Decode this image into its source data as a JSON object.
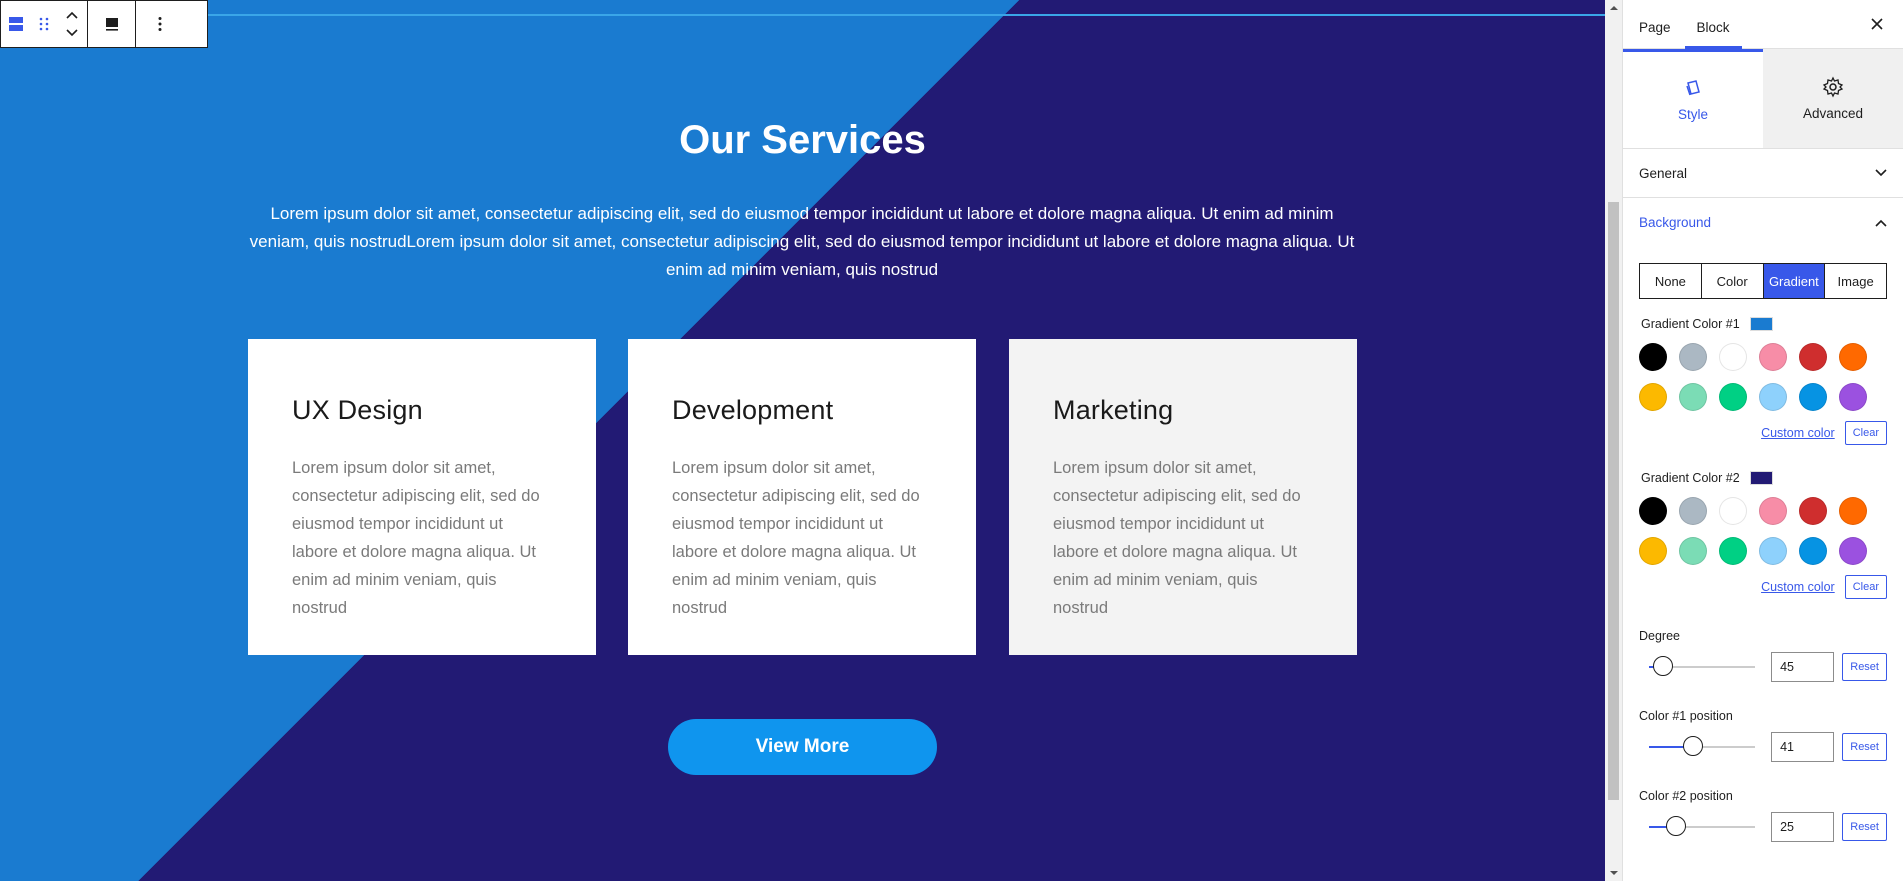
{
  "toolbar": {
    "block_type_icon": "section-layout-icon",
    "drag_icon": "drag-handle-icon",
    "move_icon": "move-up-down-icon",
    "align_icon": "align-block-icon",
    "more_icon": "more-options-icon"
  },
  "section": {
    "title": "Our Services",
    "description": "Lorem ipsum dolor sit amet, consectetur adipiscing elit, sed do eiusmod tempor incididunt ut labore et dolore magna aliqua. Ut enim ad minim veniam, quis nostrudLorem ipsum dolor sit amet, consectetur adipiscing elit, sed do eiusmod tempor incididunt ut labore et dolore magna aliqua. Ut enim ad minim veniam, quis nostrud",
    "cards": [
      {
        "title": "UX Design",
        "text": "Lorem ipsum dolor sit amet, consectetur adipiscing elit, sed do eiusmod tempor incididunt ut labore et dolore magna aliqua. Ut enim ad minim veniam, quis nostrud"
      },
      {
        "title": "Development",
        "text": "Lorem ipsum dolor sit amet, consectetur adipiscing elit, sed do eiusmod tempor incididunt ut labore et dolore magna aliqua. Ut enim ad minim veniam, quis nostrud"
      },
      {
        "title": "Marketing",
        "text": "Lorem ipsum dolor sit amet, consectetur adipiscing elit, sed do eiusmod tempor incididunt ut labore et dolore magna aliqua. Ut enim ad minim veniam, quis nostrud"
      }
    ],
    "button_label": "View More",
    "colors": {
      "gradient1": "#1a7bd0",
      "gradient2": "#221a74",
      "button": "#0f95ee"
    }
  },
  "sidebar": {
    "tabs": [
      "Page",
      "Block"
    ],
    "active_tab": "Block",
    "panel_tabs": {
      "style": "Style",
      "advanced": "Advanced"
    },
    "accordion": {
      "general": "General",
      "background": "Background"
    },
    "bg_types": [
      "None",
      "Color",
      "Gradient",
      "Image"
    ],
    "active_bg_type": "Gradient",
    "gradient_color_1": {
      "label": "Gradient Color #1",
      "value": "#1a7bd0"
    },
    "gradient_color_2": {
      "label": "Gradient Color #2",
      "value": "#221a74"
    },
    "palette": [
      "#000000",
      "#abb8c3",
      "#ffffff",
      "#f78da7",
      "#cf2e2e",
      "#ff6900",
      "#fcb900",
      "#7bdcb5",
      "#00d084",
      "#8ed1fc",
      "#0693e3",
      "#9b51e0"
    ],
    "custom_color_label": "Custom color",
    "clear_label": "Clear",
    "degree": {
      "label": "Degree",
      "value": "45",
      "fraction": 0.125
    },
    "color1_position": {
      "label": "Color #1 position",
      "value": "41",
      "fraction": 0.41
    },
    "color2_position": {
      "label": "Color #2 position",
      "value": "25",
      "fraction": 0.25
    },
    "reset_label": "Reset",
    "accent": "#3858e9"
  }
}
